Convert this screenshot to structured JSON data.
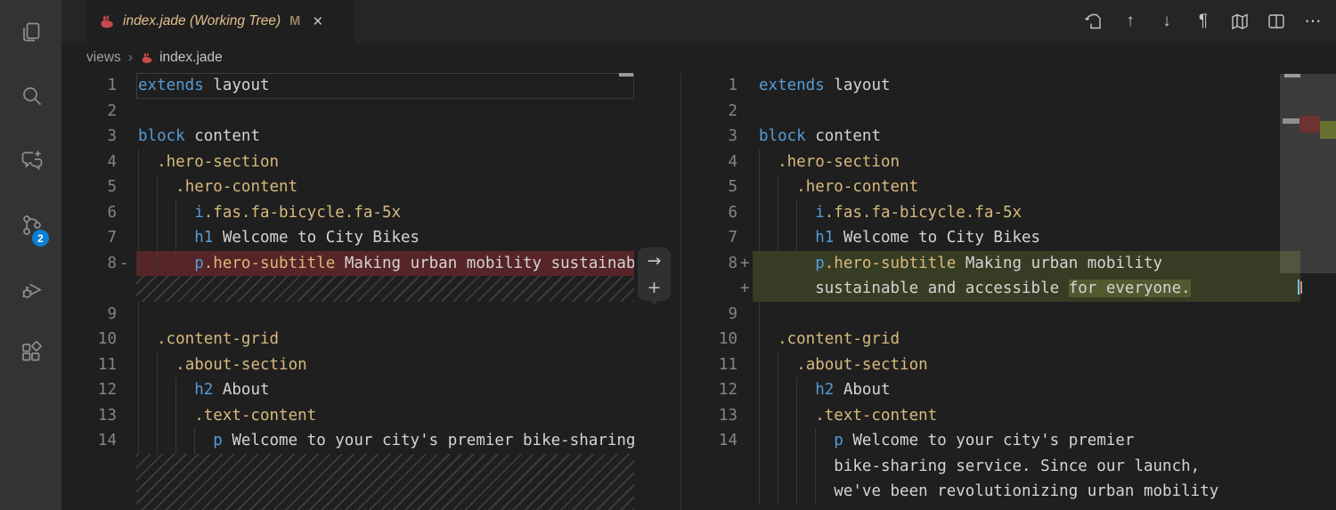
{
  "tab": {
    "title": "index.jade (Working Tree)",
    "status_badge": "M",
    "close_glyph": "×"
  },
  "breadcrumbs": {
    "folder": "views",
    "separator": "›",
    "file": "index.jade"
  },
  "toolbar": {
    "prev_glyph": "↑",
    "next_glyph": "↓",
    "pilcrow_glyph": "¶",
    "more_glyph": "⋯"
  },
  "activity_bar": {
    "scm_badge": "2"
  },
  "diff_widget": {
    "revert_glyph": "→",
    "add_glyph": "+"
  },
  "colors": {
    "keyword": "#569cd6",
    "class_name": "#d7ba7d",
    "default_text": "#d4d4d4",
    "removed_line_bg": "#572527",
    "added_line_bg": "#373d24",
    "added_char_bg": "#51592f",
    "modified_tab_label": "#e2c08d",
    "badge_bg": "#0a7fd4",
    "activity_bar_bg": "#333333",
    "editor_bg": "#1f1f1f"
  },
  "editors": {
    "left": {
      "rows": [
        {
          "n": "1",
          "g": 0,
          "cur": true,
          "tok": [
            [
              "kw",
              "extends"
            ],
            [
              "fg",
              " layout"
            ]
          ]
        },
        {
          "n": "2",
          "g": 0,
          "tok": []
        },
        {
          "n": "3",
          "g": 0,
          "tok": [
            [
              "kw",
              "block"
            ],
            [
              "fg",
              " content"
            ]
          ]
        },
        {
          "n": "4",
          "g": 1,
          "tok": [
            [
              "fg",
              "  "
            ],
            [
              "cls",
              ".hero-section"
            ]
          ]
        },
        {
          "n": "5",
          "g": 2,
          "tok": [
            [
              "fg",
              "    "
            ],
            [
              "cls",
              ".hero-content"
            ]
          ]
        },
        {
          "n": "6",
          "g": 3,
          "tok": [
            [
              "fg",
              "      "
            ],
            [
              "kw",
              "i"
            ],
            [
              "cls",
              ".fas.fa-bicycle.fa-5x"
            ]
          ]
        },
        {
          "n": "7",
          "g": 3,
          "tok": [
            [
              "fg",
              "      "
            ],
            [
              "kw",
              "h1"
            ],
            [
              "fg",
              " Welcome to City Bikes"
            ]
          ]
        },
        {
          "n": "8",
          "s": "-",
          "bg": "del",
          "g": 3,
          "tok": [
            [
              "fg",
              "      "
            ],
            [
              "kw",
              "p"
            ],
            [
              "cls",
              ".hero-subtitle"
            ],
            [
              "fg",
              " Making urban mobility sustainable."
            ]
          ]
        },
        {
          "hatch": 1
        },
        {
          "n": "9",
          "g": 1,
          "tok": []
        },
        {
          "n": "10",
          "g": 1,
          "tok": [
            [
              "fg",
              "  "
            ],
            [
              "cls",
              ".content-grid"
            ]
          ]
        },
        {
          "n": "11",
          "g": 2,
          "tok": [
            [
              "fg",
              "    "
            ],
            [
              "cls",
              ".about-section"
            ]
          ]
        },
        {
          "n": "12",
          "g": 3,
          "tok": [
            [
              "fg",
              "      "
            ],
            [
              "kw",
              "h2"
            ],
            [
              "fg",
              " About"
            ]
          ]
        },
        {
          "n": "13",
          "g": 3,
          "tok": [
            [
              "fg",
              "      "
            ],
            [
              "cls",
              ".text-content"
            ]
          ]
        },
        {
          "n": "14",
          "g": 4,
          "tok": [
            [
              "fg",
              "        "
            ],
            [
              "kw",
              "p"
            ],
            [
              "fg",
              " Welcome to your city's premier bike-sharing service."
            ]
          ]
        },
        {
          "hatch": "fill"
        }
      ]
    },
    "right": {
      "rows": [
        {
          "n": "1",
          "g": 0,
          "tok": [
            [
              "kw",
              "extends"
            ],
            [
              "fg",
              " layout"
            ]
          ]
        },
        {
          "n": "2",
          "g": 0,
          "tok": []
        },
        {
          "n": "3",
          "g": 0,
          "tok": [
            [
              "kw",
              "block"
            ],
            [
              "fg",
              " content"
            ]
          ]
        },
        {
          "n": "4",
          "g": 1,
          "tok": [
            [
              "fg",
              "  "
            ],
            [
              "cls",
              ".hero-section"
            ]
          ]
        },
        {
          "n": "5",
          "g": 2,
          "tok": [
            [
              "fg",
              "    "
            ],
            [
              "cls",
              ".hero-content"
            ]
          ]
        },
        {
          "n": "6",
          "g": 3,
          "tok": [
            [
              "fg",
              "      "
            ],
            [
              "kw",
              "i"
            ],
            [
              "cls",
              ".fas.fa-bicycle.fa-5x"
            ]
          ]
        },
        {
          "n": "7",
          "g": 3,
          "tok": [
            [
              "fg",
              "      "
            ],
            [
              "kw",
              "h1"
            ],
            [
              "fg",
              " Welcome to City Bikes"
            ]
          ]
        },
        {
          "n": "8",
          "s": "+",
          "bg": "add",
          "g": 3,
          "tok": [
            [
              "fg",
              "      "
            ],
            [
              "kw",
              "p"
            ],
            [
              "cls",
              ".hero-subtitle"
            ],
            [
              "fg",
              " Making urban mobility"
            ]
          ]
        },
        {
          "n": "",
          "s": "+",
          "bg": "add",
          "g": 3,
          "tok": [
            [
              "fg",
              "      "
            ],
            [
              "fg",
              "sustainable and accessible "
            ],
            [
              "hl",
              "for everyone."
            ]
          ]
        },
        {
          "n": "9",
          "g": 1,
          "tok": []
        },
        {
          "n": "10",
          "g": 1,
          "tok": [
            [
              "fg",
              "  "
            ],
            [
              "cls",
              ".content-grid"
            ]
          ]
        },
        {
          "n": "11",
          "g": 2,
          "tok": [
            [
              "fg",
              "    "
            ],
            [
              "cls",
              ".about-section"
            ]
          ]
        },
        {
          "n": "12",
          "g": 3,
          "tok": [
            [
              "fg",
              "      "
            ],
            [
              "kw",
              "h2"
            ],
            [
              "fg",
              " About"
            ]
          ]
        },
        {
          "n": "13",
          "g": 3,
          "tok": [
            [
              "fg",
              "      "
            ],
            [
              "cls",
              ".text-content"
            ]
          ]
        },
        {
          "n": "14",
          "g": 4,
          "tok": [
            [
              "fg",
              "        "
            ],
            [
              "kw",
              "p"
            ],
            [
              "fg",
              " Welcome to your city's premier"
            ]
          ]
        },
        {
          "n": "",
          "g": 4,
          "tok": [
            [
              "fg",
              "        "
            ],
            [
              "fg",
              "bike-sharing service. Since our launch,"
            ]
          ]
        },
        {
          "n": "",
          "g": 4,
          "tok": [
            [
              "fg",
              "        "
            ],
            [
              "fg",
              "we've been revolutionizing urban mobility"
            ]
          ]
        }
      ]
    }
  }
}
